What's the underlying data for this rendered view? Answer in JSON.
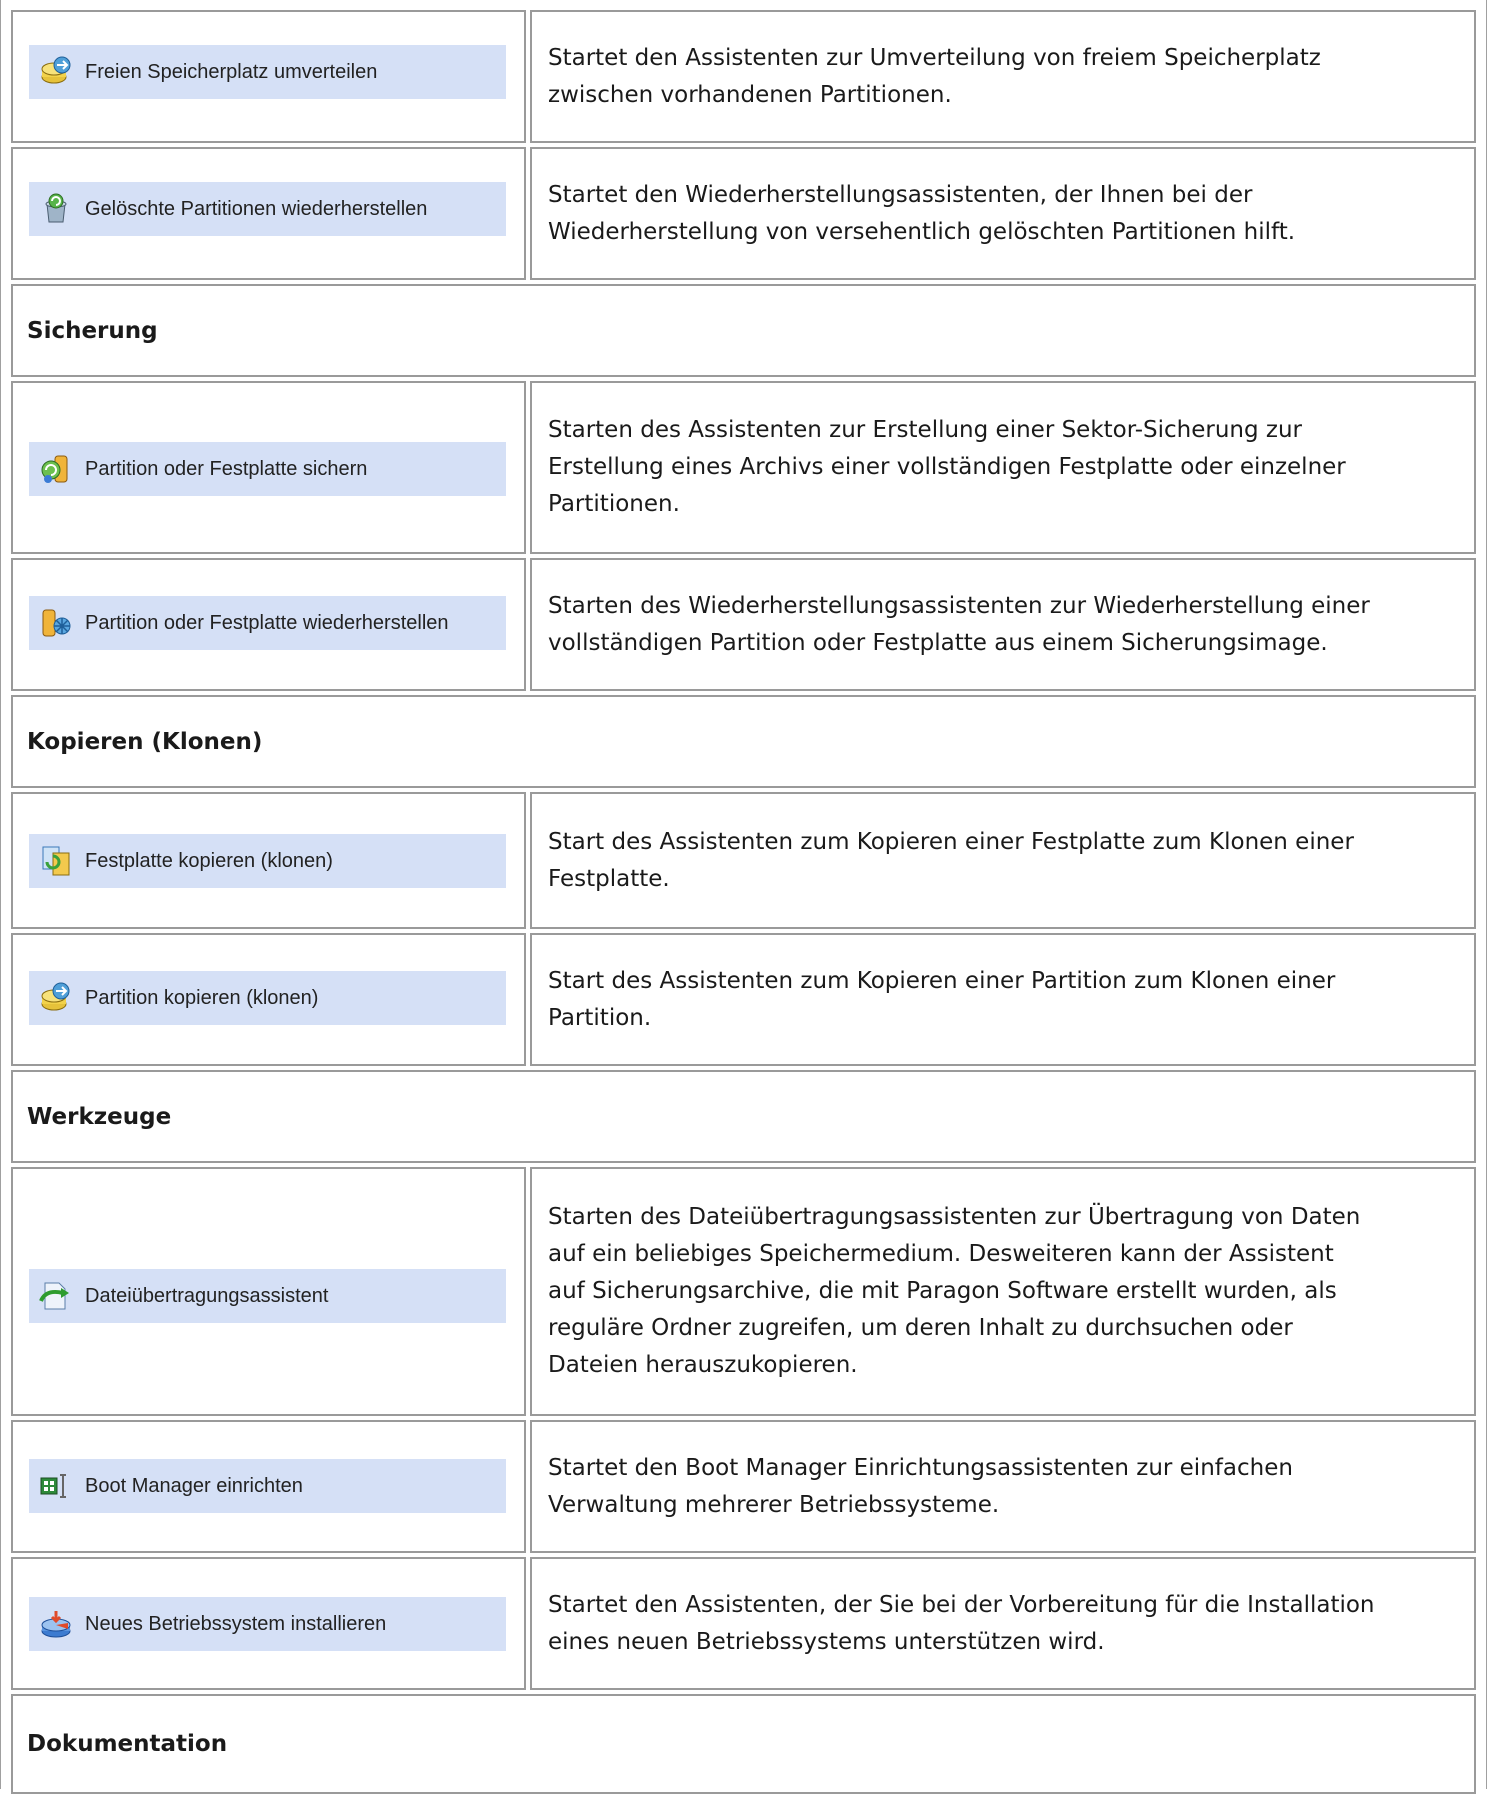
{
  "rows": [
    {
      "button": "Freien Speicherplatz umverteilen",
      "icon": "disk-arrows-icon",
      "desc": [
        "Startet den Assistenten zur Umverteilung von freiem Speicherplatz",
        "zwischen vorhandenen Partitionen."
      ]
    },
    {
      "button": "Gelöschte Partitionen wiederherstellen",
      "icon": "recycle-bin-icon",
      "desc": [
        "Startet den Wiederherstellungsassistenten, der Ihnen bei der",
        "Wiederherstellung von versehentlich gelöschten Partitionen hilft."
      ]
    },
    {
      "section": "Sicherung"
    },
    {
      "button": "Partition oder Festplatte sichern",
      "icon": "backup-icon",
      "desc": [
        "Starten des Assistenten zur Erstellung einer Sektor-Sicherung zur",
        "Erstellung eines Archivs einer vollständigen Festplatte oder einzelner",
        "Partitionen."
      ]
    },
    {
      "button": "Partition oder Festplatte wiederherstellen",
      "icon": "restore-icon",
      "desc": [
        "Starten des Wiederherstellungsassistenten zur Wiederherstellung einer",
        "vollständigen Partition oder Festplatte aus einem Sicherungsimage."
      ]
    },
    {
      "section": "Kopieren (Klonen)"
    },
    {
      "button": "Festplatte kopieren (klonen)",
      "icon": "copy-disk-icon",
      "desc": [
        "Start des Assistenten zum Kopieren einer Festplatte zum Klonen einer",
        "Festplatte."
      ]
    },
    {
      "button": "Partition kopieren (klonen)",
      "icon": "copy-partition-icon",
      "desc": [
        "Start des Assistenten zum Kopieren einer Partition zum Klonen einer",
        "Partition."
      ]
    },
    {
      "section": "Werkzeuge"
    },
    {
      "button": "Dateiübertragungsassistent",
      "icon": "file-transfer-icon",
      "desc": [
        "Starten des Dateiübertragungsassistenten zur Übertragung von Daten",
        "auf ein beliebiges Speichermedium. Desweiteren kann der Assistent",
        "auf Sicherungsarchive, die mit Paragon Software erstellt wurden, als",
        "reguläre Ordner zugreifen, um deren Inhalt zu durchsuchen oder",
        "Dateien herauszukopieren."
      ]
    },
    {
      "button": "Boot Manager einrichten",
      "icon": "boot-manager-icon",
      "desc": [
        "Startet den Boot Manager Einrichtungsassistenten zur einfachen",
        "Verwaltung mehrerer Betriebssysteme."
      ]
    },
    {
      "button": "Neues Betriebssystem installieren",
      "icon": "install-os-icon",
      "desc": [
        "Startet den Assistenten, der Sie bei der Vorbereitung für die Installation",
        "eines neuen Betriebssystems unterstützen wird."
      ]
    },
    {
      "section": "Dokumentation"
    }
  ]
}
